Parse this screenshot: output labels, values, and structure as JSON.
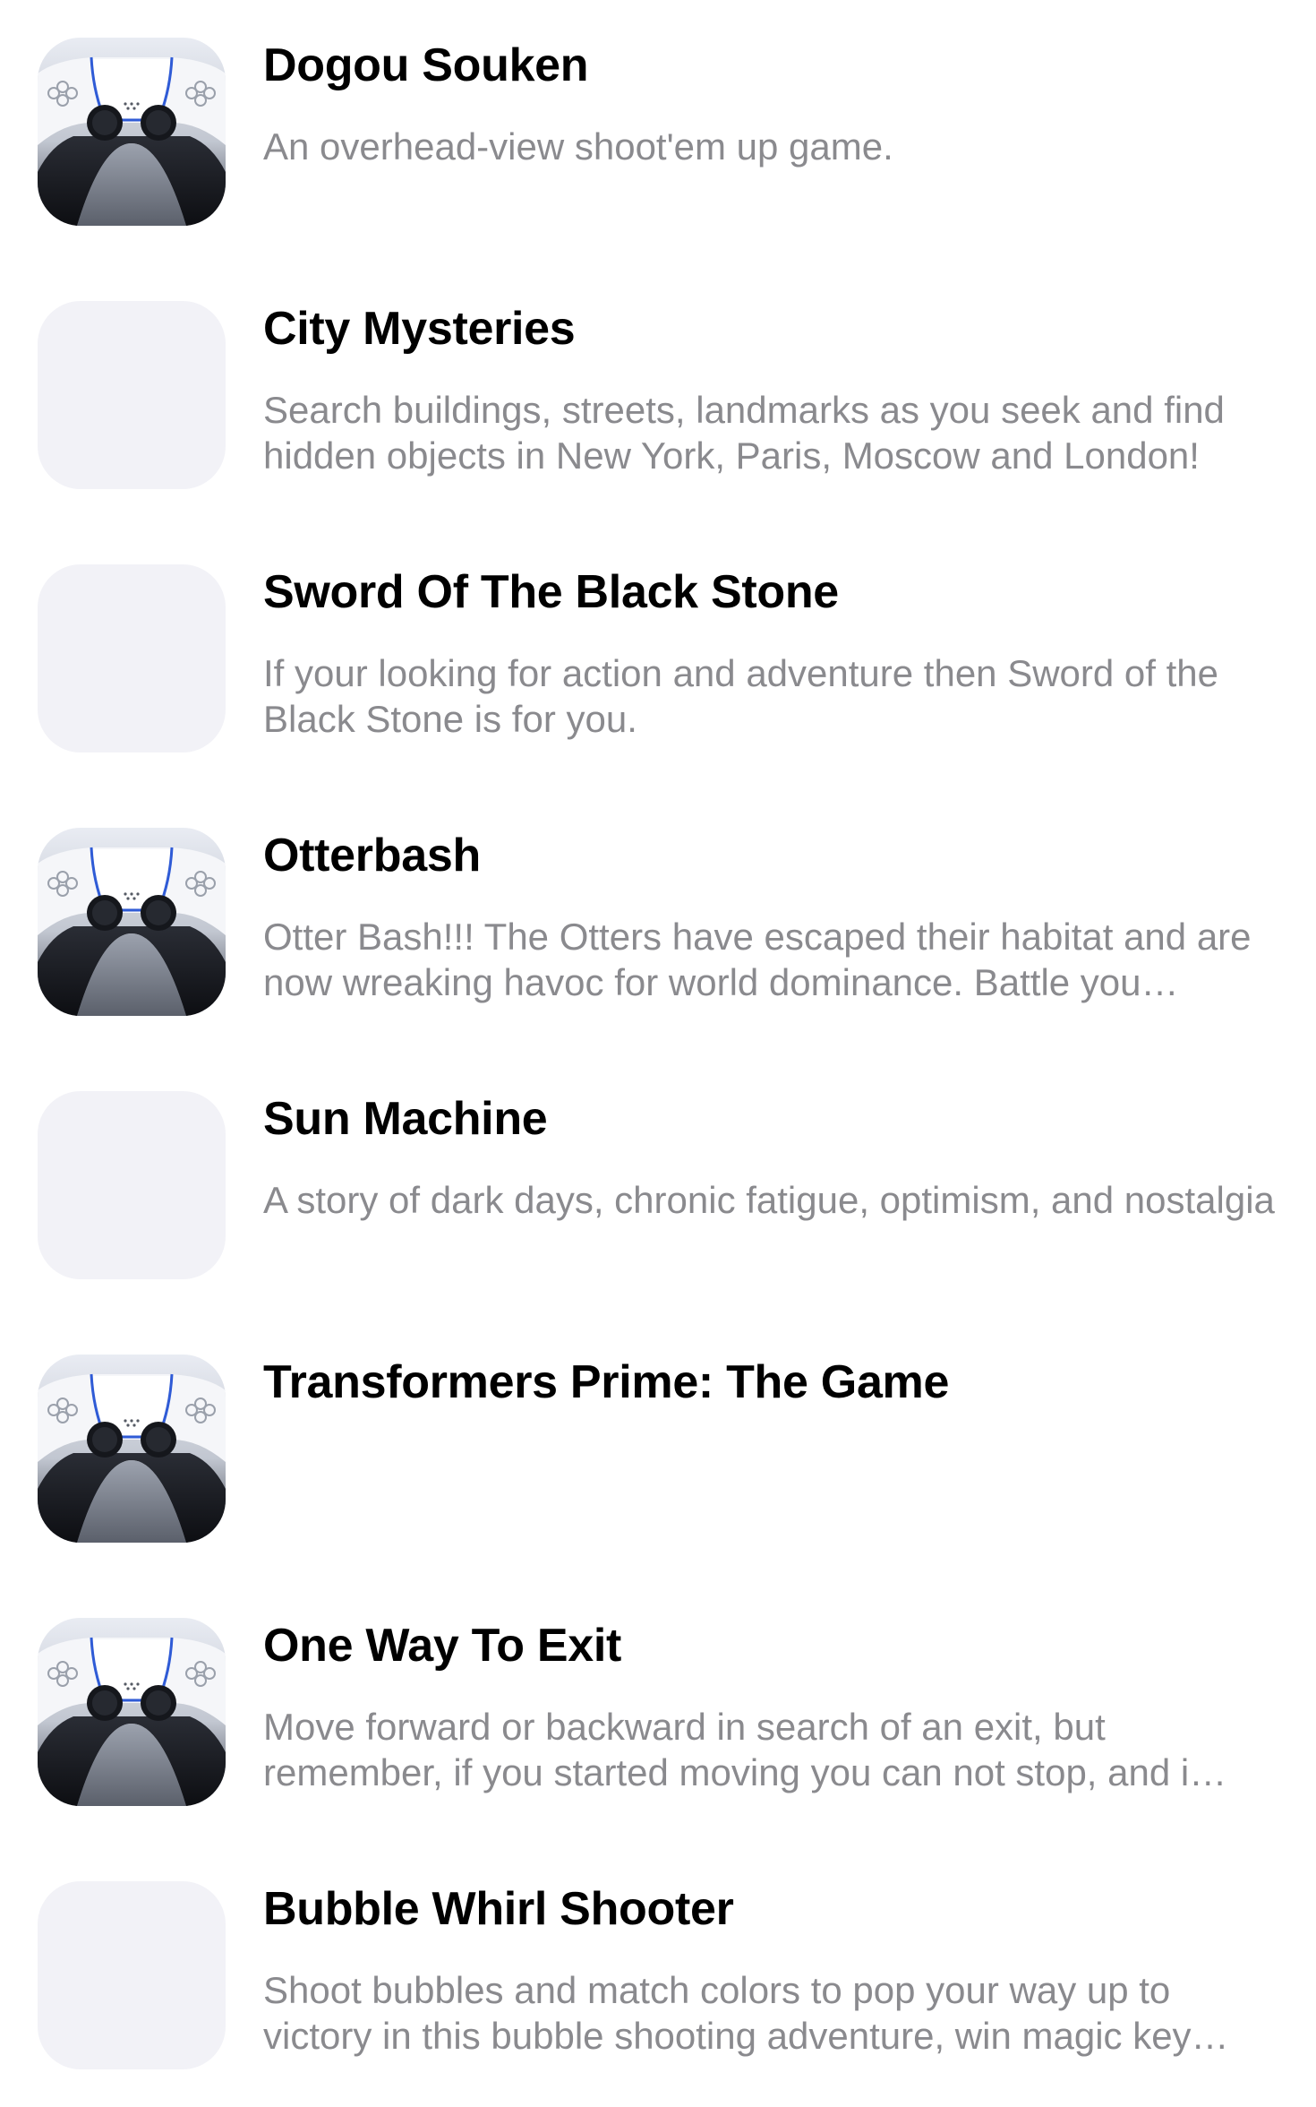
{
  "games": [
    {
      "title": "Dogou Souken",
      "description": "An overhead-view shoot'em up game.",
      "icon": "gamepad-icon"
    },
    {
      "title": "City Mysteries",
      "description": "Search buildings, streets, landmarks as you seek and find hidden objects in New York, Paris, Moscow and London!",
      "icon": "placeholder-icon"
    },
    {
      "title": "Sword Of The Black Stone",
      "description": "If your looking for action and adventure then Sword of the Black Stone is for you.",
      "icon": "placeholder-icon"
    },
    {
      "title": "Otterbash",
      "description": "Otter Bash!!! The Otters have escaped their habitat and are now wreaking havoc for world dominance. Battle you…",
      "icon": "gamepad-icon"
    },
    {
      "title": "Sun Machine",
      "description": "A story of dark days, chronic fatigue, optimism, and nostalgia",
      "icon": "placeholder-icon"
    },
    {
      "title": "Transformers Prime: The Game",
      "description": "",
      "icon": "gamepad-icon"
    },
    {
      "title": "One Way To Exit",
      "description": "Move forward or backward in search of an exit, but remember, if you started moving you can not stop, and i…",
      "icon": "gamepad-icon"
    },
    {
      "title": "Bubble Whirl Shooter",
      "description": "Shoot bubbles and match colors to pop your way up to victory in this bubble shooting adventure, win magic key…",
      "icon": "placeholder-icon"
    }
  ],
  "colors": {
    "title": "#000000",
    "description": "#8a8a8e",
    "placeholder": "#f2f2f7",
    "background": "#ffffff"
  }
}
